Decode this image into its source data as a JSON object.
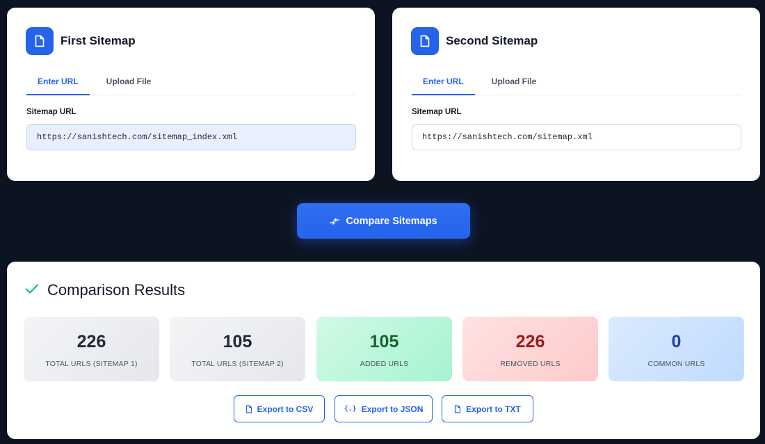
{
  "first_sitemap": {
    "title": "First Sitemap",
    "tabs": [
      {
        "label": "Enter URL",
        "active": true
      },
      {
        "label": "Upload File",
        "active": false
      }
    ],
    "field_label": "Sitemap URL",
    "url_value": "https://sanishtech.com/sitemap_index.xml"
  },
  "second_sitemap": {
    "title": "Second Sitemap",
    "tabs": [
      {
        "label": "Enter URL",
        "active": true
      },
      {
        "label": "Upload File",
        "active": false
      }
    ],
    "field_label": "Sitemap URL",
    "url_value": "https://sanishtech.com/sitemap.xml"
  },
  "compare_button": {
    "label": "Compare Sitemaps",
    "icon": "compare-arrows-icon"
  },
  "results": {
    "title": "Comparison Results",
    "icon": "checkmark-icon",
    "stats": [
      {
        "value": "226",
        "label": "TOTAL URLS (SITEMAP 1)"
      },
      {
        "value": "105",
        "label": "TOTAL URLS (SITEMAP 2)"
      },
      {
        "value": "105",
        "label": "ADDED URLS"
      },
      {
        "value": "226",
        "label": "REMOVED URLS"
      },
      {
        "value": "0",
        "label": "COMMON URLS"
      }
    ],
    "exports": [
      {
        "label": "Export to CSV",
        "icon": "file-icon"
      },
      {
        "label": "Export to JSON",
        "icon": "braces-icon"
      },
      {
        "label": "Export to TXT",
        "icon": "file-icon"
      }
    ]
  },
  "colors": {
    "background": "#0d1421",
    "accent": "#2563eb",
    "success": "#10b981",
    "added_value": "#166534",
    "removed_value": "#991b1b",
    "common_value": "#1e40af"
  }
}
